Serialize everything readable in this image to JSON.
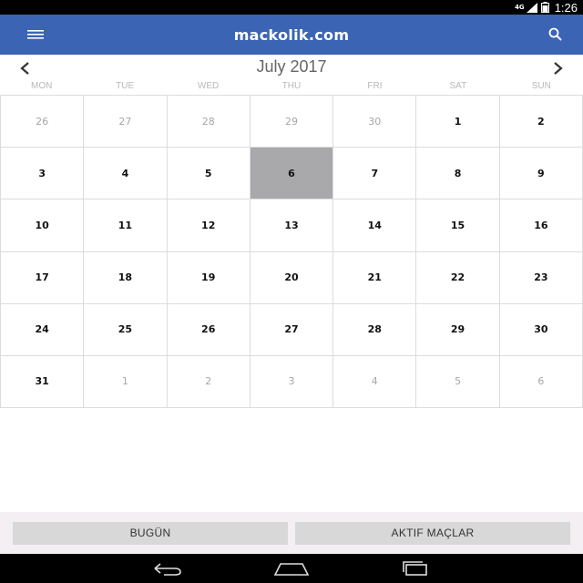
{
  "status_bar": {
    "network": "4G",
    "time": "1:26"
  },
  "app_bar": {
    "brand": "mackolik.com"
  },
  "calendar": {
    "title": "July 2017",
    "weekdays": [
      "MON",
      "TUE",
      "WED",
      "THU",
      "FRI",
      "SAT",
      "SUN"
    ],
    "days": [
      {
        "label": "26",
        "state": "muted"
      },
      {
        "label": "27",
        "state": "muted"
      },
      {
        "label": "28",
        "state": "muted"
      },
      {
        "label": "29",
        "state": "muted"
      },
      {
        "label": "30",
        "state": "muted"
      },
      {
        "label": "1",
        "state": "cur"
      },
      {
        "label": "2",
        "state": "cur"
      },
      {
        "label": "3",
        "state": "cur"
      },
      {
        "label": "4",
        "state": "cur"
      },
      {
        "label": "5",
        "state": "cur"
      },
      {
        "label": "6",
        "state": "sel"
      },
      {
        "label": "7",
        "state": "cur"
      },
      {
        "label": "8",
        "state": "cur"
      },
      {
        "label": "9",
        "state": "cur"
      },
      {
        "label": "10",
        "state": "cur"
      },
      {
        "label": "11",
        "state": "cur"
      },
      {
        "label": "12",
        "state": "cur"
      },
      {
        "label": "13",
        "state": "cur"
      },
      {
        "label": "14",
        "state": "cur"
      },
      {
        "label": "15",
        "state": "cur"
      },
      {
        "label": "16",
        "state": "cur"
      },
      {
        "label": "17",
        "state": "cur"
      },
      {
        "label": "18",
        "state": "cur"
      },
      {
        "label": "19",
        "state": "cur"
      },
      {
        "label": "20",
        "state": "cur"
      },
      {
        "label": "21",
        "state": "cur"
      },
      {
        "label": "22",
        "state": "cur"
      },
      {
        "label": "23",
        "state": "cur"
      },
      {
        "label": "24",
        "state": "cur"
      },
      {
        "label": "25",
        "state": "cur"
      },
      {
        "label": "26",
        "state": "cur"
      },
      {
        "label": "27",
        "state": "cur"
      },
      {
        "label": "28",
        "state": "cur"
      },
      {
        "label": "29",
        "state": "cur"
      },
      {
        "label": "30",
        "state": "cur"
      },
      {
        "label": "31",
        "state": "cur"
      },
      {
        "label": "1",
        "state": "muted"
      },
      {
        "label": "2",
        "state": "muted"
      },
      {
        "label": "3",
        "state": "muted"
      },
      {
        "label": "4",
        "state": "muted"
      },
      {
        "label": "5",
        "state": "muted"
      },
      {
        "label": "6",
        "state": "muted"
      }
    ]
  },
  "bottom_buttons": {
    "today": "BUGÜN",
    "live": "AKTIF MAÇLAR"
  },
  "colors": {
    "app_bar": "#3c64b4",
    "selected_day": "#a9a8ab",
    "muted_text": "#a6a6a6",
    "grid_line": "#dcdcdc"
  },
  "icons": {
    "menu": "hamburger-icon",
    "search": "search-icon",
    "prev": "chevron-left-icon",
    "next": "chevron-right-icon",
    "back": "back-icon",
    "home": "home-icon",
    "recents": "recents-icon"
  }
}
